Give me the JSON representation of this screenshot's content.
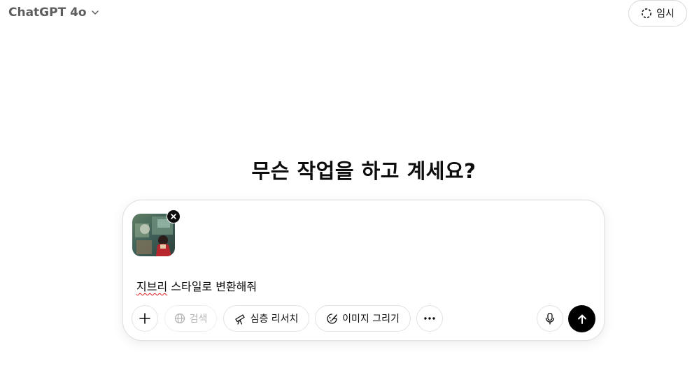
{
  "header": {
    "model_name": "ChatGPT 4o",
    "temp_chat_label": "임시"
  },
  "main": {
    "headline": "무슨 작업을 하고 계세요?"
  },
  "composer": {
    "attachment_icon": "image-thumbnail",
    "prompt_word_misspelled": "지브리",
    "prompt_rest": " 스타일로 변환해줘",
    "tools": {
      "add_icon": "plus-icon",
      "search_label": "검색",
      "research_label": "심층 리서치",
      "image_label": "이미지 그리기",
      "more_icon": "ellipsis-icon",
      "mic_icon": "microphone-icon",
      "send_icon": "arrow-up-icon"
    }
  },
  "colors": {
    "send_button": "#000000",
    "spellcheck_underline": "#e02020"
  }
}
